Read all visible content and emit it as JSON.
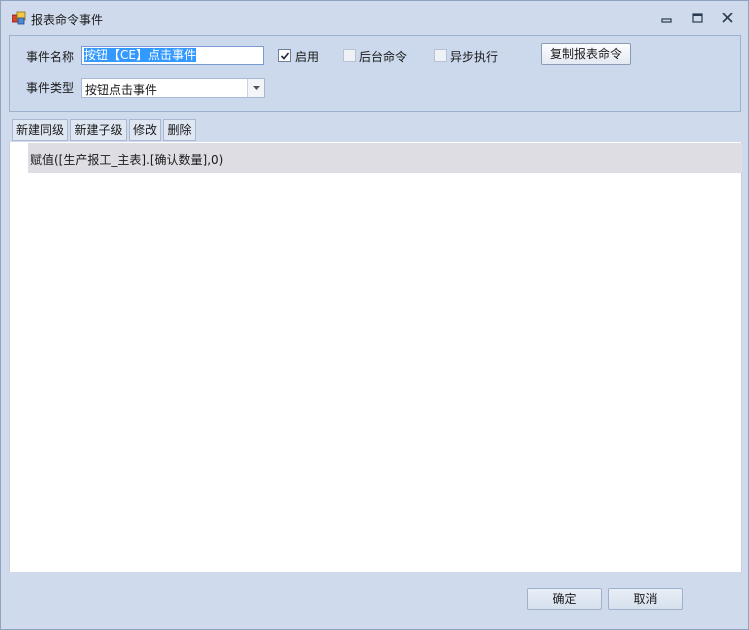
{
  "window": {
    "title": "报表命令事件"
  },
  "form": {
    "name_label": "事件名称",
    "name_value": "按钮【CE】点击事件",
    "type_label": "事件类型",
    "type_value": "按钮点击事件",
    "enable_label": "启用",
    "enable_checked": true,
    "background_label": "后台命令",
    "background_checked": false,
    "async_label": "异步执行",
    "async_checked": false,
    "copy_button": "复制报表命令"
  },
  "toolbar": {
    "new_sibling": "新建同级",
    "new_child": "新建子级",
    "edit": "修改",
    "delete": "删除"
  },
  "commands": [
    {
      "text": "赋值([生产报工_主表].[确认数量],0)"
    }
  ],
  "footer": {
    "ok": "确定",
    "cancel": "取消"
  }
}
